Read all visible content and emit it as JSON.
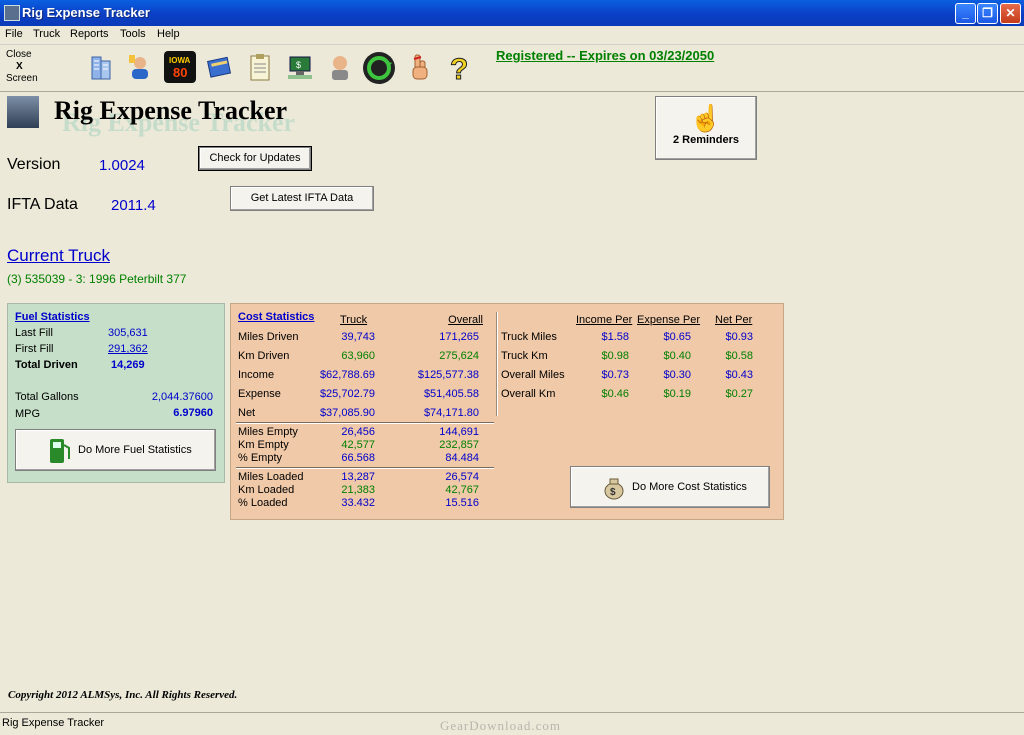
{
  "window": {
    "title": "Rig Expense Tracker",
    "min": "_",
    "max": "❐",
    "close": "✕"
  },
  "menu": [
    "File",
    "Truck",
    "Reports",
    "Tools",
    "Help"
  ],
  "toolbar": {
    "close_label_1": "Close",
    "close_label_2": "X",
    "close_label_3": "Screen",
    "registered": "Registered -- Expires on 03/23/2050"
  },
  "header": {
    "title": "Rig Expense Tracker",
    "shadow_title": "Rig Expense Tracker",
    "version_label": "Version",
    "version_value": "1.0024",
    "check_updates": "Check for Updates",
    "ifta_label": "IFTA Data",
    "ifta_value": "2011.4",
    "get_ifta": "Get Latest IFTA Data",
    "reminders": "2 Reminders"
  },
  "truck": {
    "heading": "Current Truck",
    "value": "(3) 535039 - 3: 1996 Peterbilt 377"
  },
  "fuel": {
    "heading": "Fuel Statistics",
    "last_fill_label": "Last Fill",
    "last_fill": "305,631",
    "first_fill_label": "First Fill",
    "first_fill": "291,362",
    "total_driven_label": "Total Driven",
    "total_driven": "14,269",
    "total_gallons_label": "Total Gallons",
    "total_gallons": "2,044.37600",
    "mpg_label": "MPG",
    "mpg": "6.97960",
    "button": "Do More Fuel Statistics"
  },
  "cost": {
    "heading": "Cost Statistics",
    "col_truck": "Truck",
    "col_overall": "Overall",
    "rows": [
      {
        "label": "Miles Driven",
        "truck": "39,743",
        "overall": "171,265"
      },
      {
        "label": "Km Driven",
        "truck": "63,960",
        "overall": "275,624"
      },
      {
        "label": "Income",
        "truck": "$62,788.69",
        "overall": "$125,577.38"
      },
      {
        "label": "Expense",
        "truck": "$25,702.79",
        "overall": "$51,405.58"
      },
      {
        "label": "Net",
        "truck": "$37,085.90",
        "overall": "$74,171.80"
      }
    ],
    "empty": [
      {
        "label": "Miles Empty",
        "truck": "26,456",
        "overall": "144,691"
      },
      {
        "label": "Km Empty",
        "truck": "42,577",
        "overall": "232,857"
      },
      {
        "label": "% Empty",
        "truck": "66.568",
        "overall": "84.484"
      }
    ],
    "loaded": [
      {
        "label": "Miles Loaded",
        "truck": "13,287",
        "overall": "26,574"
      },
      {
        "label": "Km Loaded",
        "truck": "21,383",
        "overall": "42,767"
      },
      {
        "label": "% Loaded",
        "truck": "33.432",
        "overall": "15.516"
      }
    ],
    "per_headers": {
      "income": "Income Per",
      "expense": "Expense Per",
      "net": "Net Per"
    },
    "per_rows": [
      {
        "label": "Truck Miles",
        "income": "$1.58",
        "expense": "$0.65",
        "net": "$0.93"
      },
      {
        "label": "Truck Km",
        "income": "$0.98",
        "expense": "$0.40",
        "net": "$0.58"
      },
      {
        "label": "Overall Miles",
        "income": "$0.73",
        "expense": "$0.30",
        "net": "$0.43"
      },
      {
        "label": "Overall Km",
        "income": "$0.46",
        "expense": "$0.19",
        "net": "$0.27"
      }
    ],
    "button": "Do More Cost Statistics"
  },
  "footer": {
    "copyright": "Copyright 2012 ALMSys, Inc. All Rights Reserved.",
    "status": "Rig Expense Tracker",
    "watermark": "GearDownload.com"
  },
  "colors": {
    "titlebar": "#0b3fc5",
    "fuel_panel": "#c5dfc8",
    "cost_panel": "#efc9a8",
    "link_blue": "#0000cc",
    "green": "#008000"
  }
}
